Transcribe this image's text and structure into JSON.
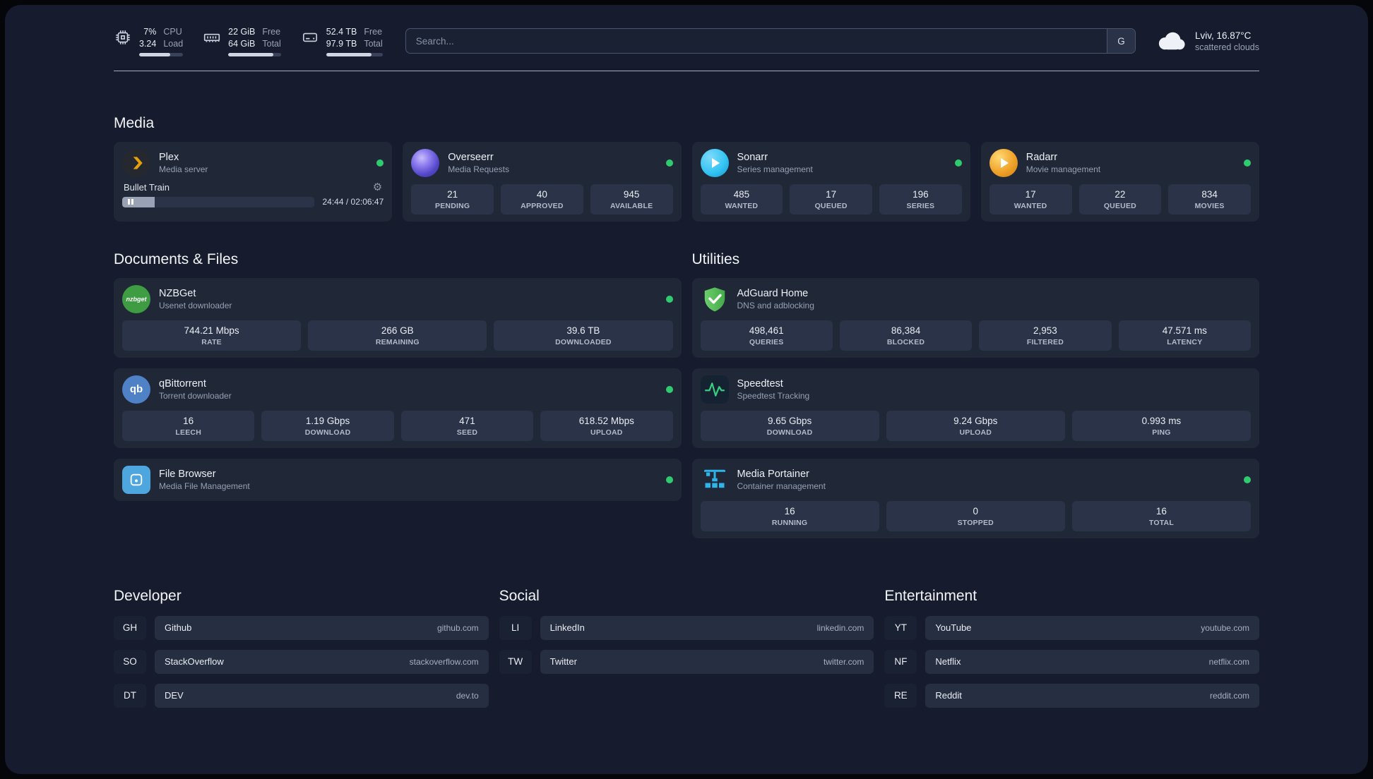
{
  "topbar": {
    "resources": [
      {
        "value_top": "7%",
        "value_bottom": "3.24",
        "label_top": "CPU",
        "label_bottom": "Load",
        "bar_pct": 70
      },
      {
        "value_top": "22 GiB",
        "value_bottom": "64 GiB",
        "label_top": "Free",
        "label_bottom": "Total",
        "bar_pct": 85
      },
      {
        "value_top": "52.4 TB",
        "value_bottom": "97.9 TB",
        "label_top": "Free",
        "label_bottom": "Total",
        "bar_pct": 80
      }
    ],
    "search": {
      "placeholder": "Search...",
      "button_label": "G"
    },
    "weather": {
      "location": "Lviv, 16.87°C",
      "condition": "scattered clouds"
    }
  },
  "sections": {
    "media": "Media",
    "documents": "Documents & Files",
    "utilities": "Utilities",
    "developer": "Developer",
    "social": "Social",
    "entertainment": "Entertainment"
  },
  "media_cards": {
    "plex": {
      "name": "Plex",
      "subtitle": "Media server",
      "player": {
        "title": "Bullet Train",
        "time": "24:44 / 02:06:47",
        "progress_pct": 17
      }
    },
    "overseerr": {
      "name": "Overseerr",
      "subtitle": "Media Requests",
      "stats": [
        {
          "value": "21",
          "label": "PENDING"
        },
        {
          "value": "40",
          "label": "APPROVED"
        },
        {
          "value": "945",
          "label": "AVAILABLE"
        }
      ]
    },
    "sonarr": {
      "name": "Sonarr",
      "subtitle": "Series management",
      "stats": [
        {
          "value": "485",
          "label": "WANTED"
        },
        {
          "value": "17",
          "label": "QUEUED"
        },
        {
          "value": "196",
          "label": "SERIES"
        }
      ]
    },
    "radarr": {
      "name": "Radarr",
      "subtitle": "Movie management",
      "stats": [
        {
          "value": "17",
          "label": "WANTED"
        },
        {
          "value": "22",
          "label": "QUEUED"
        },
        {
          "value": "834",
          "label": "MOVIES"
        }
      ]
    }
  },
  "documents_cards": {
    "nzbget": {
      "name": "NZBGet",
      "subtitle": "Usenet downloader",
      "icon_text": "nzbget",
      "stats": [
        {
          "value": "744.21 Mbps",
          "label": "RATE"
        },
        {
          "value": "266 GB",
          "label": "REMAINING"
        },
        {
          "value": "39.6 TB",
          "label": "DOWNLOADED"
        }
      ]
    },
    "qbittorrent": {
      "name": "qBittorrent",
      "subtitle": "Torrent downloader",
      "icon_text": "qb",
      "stats": [
        {
          "value": "16",
          "label": "LEECH"
        },
        {
          "value": "1.19 Gbps",
          "label": "DOWNLOAD"
        },
        {
          "value": "471",
          "label": "SEED"
        },
        {
          "value": "618.52 Mbps",
          "label": "UPLOAD"
        }
      ]
    },
    "filebrowser": {
      "name": "File Browser",
      "subtitle": "Media File Management"
    }
  },
  "utilities_cards": {
    "adguard": {
      "name": "AdGuard Home",
      "subtitle": "DNS and adblocking",
      "stats": [
        {
          "value": "498,461",
          "label": "QUERIES"
        },
        {
          "value": "86,384",
          "label": "BLOCKED"
        },
        {
          "value": "2,953",
          "label": "FILTERED"
        },
        {
          "value": "47.571 ms",
          "label": "LATENCY"
        }
      ]
    },
    "speedtest": {
      "name": "Speedtest",
      "subtitle": "Speedtest Tracking",
      "stats": [
        {
          "value": "9.65 Gbps",
          "label": "DOWNLOAD"
        },
        {
          "value": "9.24 Gbps",
          "label": "UPLOAD"
        },
        {
          "value": "0.993 ms",
          "label": "PING"
        }
      ]
    },
    "portainer": {
      "name": "Media Portainer",
      "subtitle": "Container management",
      "stats": [
        {
          "value": "16",
          "label": "RUNNING"
        },
        {
          "value": "0",
          "label": "STOPPED"
        },
        {
          "value": "16",
          "label": "TOTAL"
        }
      ]
    }
  },
  "bookmarks": {
    "developer": [
      {
        "abbr": "GH",
        "name": "Github",
        "url": "github.com"
      },
      {
        "abbr": "SO",
        "name": "StackOverflow",
        "url": "stackoverflow.com"
      },
      {
        "abbr": "DT",
        "name": "DEV",
        "url": "dev.to"
      }
    ],
    "social": [
      {
        "abbr": "LI",
        "name": "LinkedIn",
        "url": "linkedin.com"
      },
      {
        "abbr": "TW",
        "name": "Twitter",
        "url": "twitter.com"
      }
    ],
    "entertainment": [
      {
        "abbr": "YT",
        "name": "YouTube",
        "url": "youtube.com"
      },
      {
        "abbr": "NF",
        "name": "Netflix",
        "url": "netflix.com"
      },
      {
        "abbr": "RE",
        "name": "Reddit",
        "url": "reddit.com"
      }
    ]
  },
  "colors": {
    "background": "#161c2e",
    "card": "#202838",
    "tile": "#2a3347",
    "status_online": "#2fcb6e",
    "accent_plex": "#e5a00d",
    "accent_sonarr": "#35c5f4",
    "accent_radarr": "#f0a22a",
    "accent_adguard": "#57c457",
    "accent_portainer": "#2fb3e8"
  }
}
